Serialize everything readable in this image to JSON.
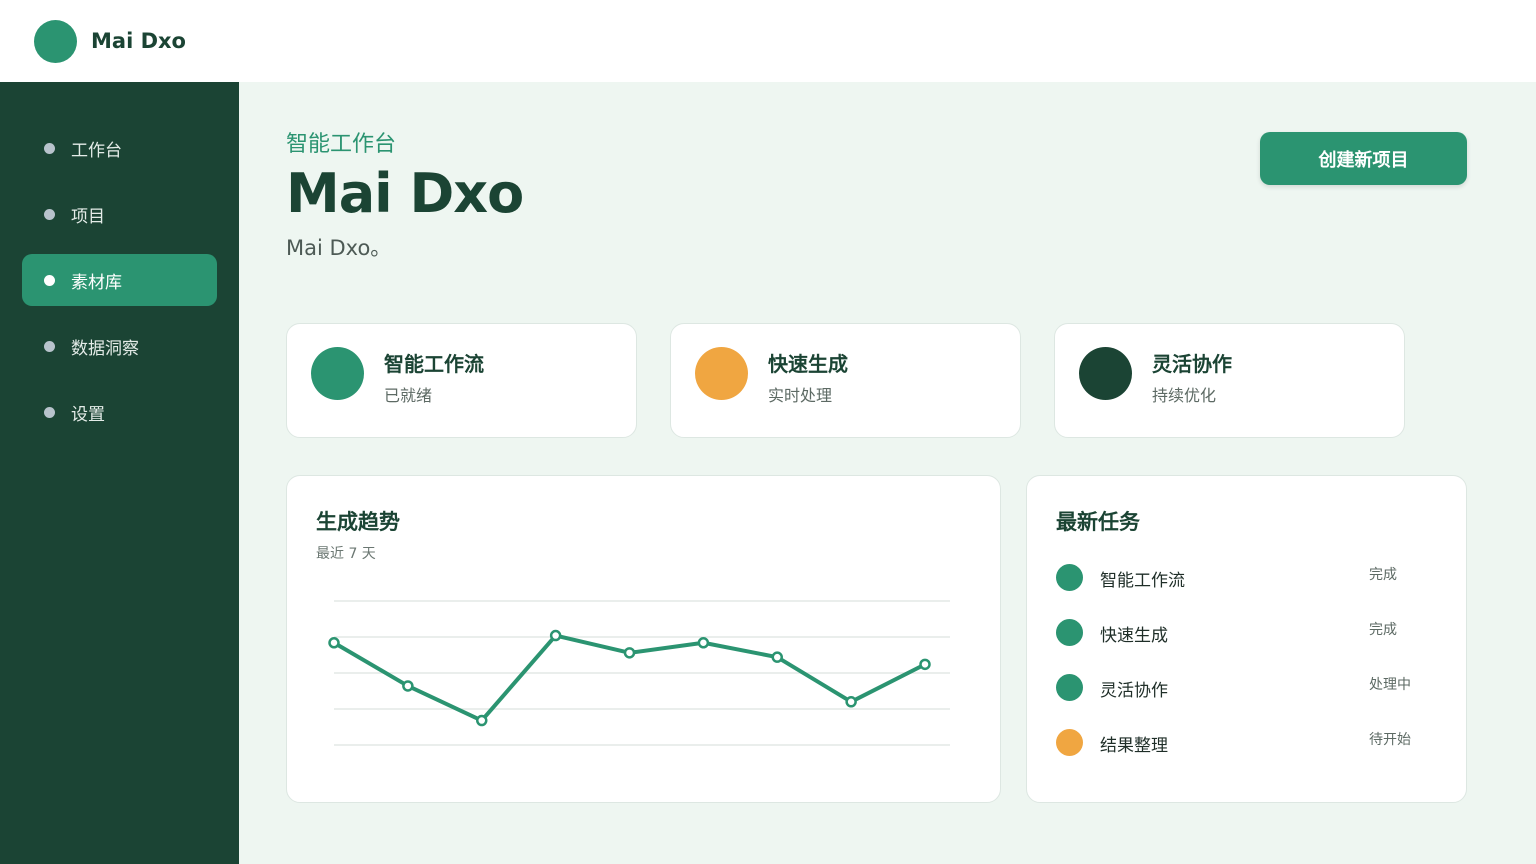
{
  "app": {
    "name": "Mai Dxo"
  },
  "sidebar": {
    "items": [
      {
        "label": "工作台",
        "active": false
      },
      {
        "label": "项目",
        "active": false
      },
      {
        "label": "素材库",
        "active": true
      },
      {
        "label": "数据洞察",
        "active": false
      },
      {
        "label": "设置",
        "active": false
      }
    ]
  },
  "hero": {
    "eyebrow": "智能工作台",
    "title": "Mai Dxo",
    "subtitle": "Mai Dxo。",
    "cta_label": "创建新项目"
  },
  "stats": [
    {
      "title": "智能工作流",
      "status": "已就绪",
      "color": "#2b9471"
    },
    {
      "title": "快速生成",
      "status": "实时处理",
      "color": "#f0a641"
    },
    {
      "title": "灵活协作",
      "status": "持续优化",
      "color": "#1b4434"
    }
  ],
  "chart": {
    "title": "生成趋势",
    "subtitle": "最近 7 天"
  },
  "chart_data": {
    "type": "line",
    "title": "生成趋势",
    "subtitle": "最近 7 天",
    "xlabel": "",
    "ylabel": "",
    "ylim": [
      0,
      100
    ],
    "grid": true,
    "values": [
      71,
      41,
      17,
      76,
      64,
      71,
      61,
      30,
      56
    ],
    "color": "#2b9471"
  },
  "tasks": {
    "title": "最新任务",
    "items": [
      {
        "name": "智能工作流",
        "status": "完成",
        "color": "#2b9471"
      },
      {
        "name": "快速生成",
        "status": "完成",
        "color": "#2b9471"
      },
      {
        "name": "灵活协作",
        "status": "处理中",
        "color": "#2b9471"
      },
      {
        "name": "结果整理",
        "status": "待开始",
        "color": "#f0a641"
      }
    ]
  }
}
